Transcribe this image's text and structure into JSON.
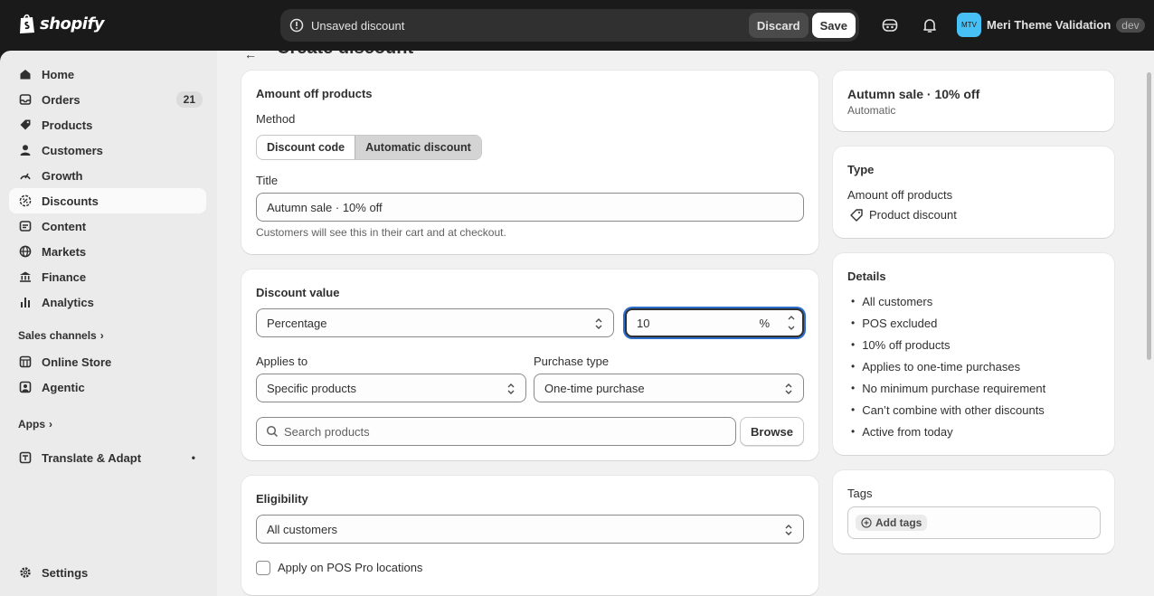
{
  "topbar": {
    "brand": "shopify",
    "unsaved_message": "Unsaved discount",
    "discard_label": "Discard",
    "save_label": "Save",
    "store_initials": "MTV",
    "store_name": "Meri Theme Validation",
    "store_tag": "dev"
  },
  "sidebar": {
    "items": [
      {
        "label": "Home",
        "icon": "home-icon"
      },
      {
        "label": "Orders",
        "icon": "inbox-icon",
        "badge": "21"
      },
      {
        "label": "Products",
        "icon": "tag-icon"
      },
      {
        "label": "Customers",
        "icon": "person-icon"
      },
      {
        "label": "Growth",
        "icon": "gauge-icon"
      },
      {
        "label": "Discounts",
        "icon": "discount-icon",
        "active": true
      },
      {
        "label": "Content",
        "icon": "content-icon"
      },
      {
        "label": "Markets",
        "icon": "globe-icon"
      },
      {
        "label": "Finance",
        "icon": "bank-icon"
      },
      {
        "label": "Analytics",
        "icon": "bar-chart-icon"
      }
    ],
    "sales_channels_label": "Sales channels",
    "channels": [
      {
        "label": "Online Store",
        "icon": "store-icon"
      },
      {
        "label": "Agentic",
        "icon": "agent-icon"
      }
    ],
    "apps_label": "Apps",
    "apps": [
      {
        "label": "Translate & Adapt",
        "icon": "app-icon",
        "dot": "•"
      }
    ],
    "settings_label": "Settings"
  },
  "page": {
    "title": "Create discount"
  },
  "method_card": {
    "heading": "Amount off products",
    "method_label": "Method",
    "method_options": [
      "Discount code",
      "Automatic discount"
    ],
    "method_selected": "Automatic discount",
    "title_label": "Title",
    "title_value": "Autumn sale · 10% off",
    "title_help": "Customers will see this in their cart and at checkout."
  },
  "value_card": {
    "heading": "Discount value",
    "value_type": "Percentage",
    "value_amount": "10",
    "value_suffix": "%",
    "applies_to_label": "Applies to",
    "applies_to_value": "Specific products",
    "purchase_type_label": "Purchase type",
    "purchase_type_value": "One-time purchase",
    "search_placeholder": "Search products",
    "browse_label": "Browse"
  },
  "eligibility_card": {
    "heading": "Eligibility",
    "value": "All customers",
    "pos_checkbox_label": "Apply on POS Pro locations",
    "pos_checked": false
  },
  "summary": {
    "title": "Autumn sale · 10% off",
    "subtitle": "Automatic",
    "type_heading": "Type",
    "type_value": "Amount off products",
    "type_detail": "Product discount",
    "details_heading": "Details",
    "details": [
      "All customers",
      "POS excluded",
      "10% off products",
      "Applies to one-time purchases",
      "No minimum purchase requirement",
      "Can’t combine with other discounts",
      "Active from today"
    ],
    "tags_heading": "Tags",
    "add_tags_label": "Add tags"
  }
}
